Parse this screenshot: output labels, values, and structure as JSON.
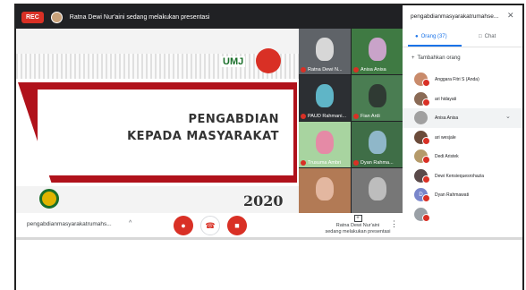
{
  "topbar": {
    "rec_label": "REC",
    "presenting_text": "Ratna Dewi Nur'aini sedang melakukan presentasi"
  },
  "slide": {
    "logo_text": "UMJ",
    "title_line1": "PENGABDIAN",
    "title_line2": "KEPADA MASYARAKAT",
    "year": "2020"
  },
  "tiles": [
    {
      "name": "Ratna Dewi N..."
    },
    {
      "name": "Anisa Anisa"
    },
    {
      "name": "PAUD Rahmani..."
    },
    {
      "name": "Fian Ardi"
    },
    {
      "name": "Trusuma Ambri"
    },
    {
      "name": "Dyan Rahma..."
    },
    {
      "name": ""
    },
    {
      "name": ""
    }
  ],
  "bottombar": {
    "meeting_name": "pengabdianmasyarakatrumahs...",
    "present_label_line1": "Ratna Dewi Nur'aini",
    "present_label_line2": "sedang melakukan presentasi"
  },
  "side": {
    "title": "pengabdianmasyarakatrumahse...",
    "tab_people": "Orang (37)",
    "tab_chat": "Chat",
    "add_people": "Tambahkan orang",
    "participants": [
      {
        "name": "Anggara Fitri S (Anda)",
        "initial": "",
        "color": "#c98b6b"
      },
      {
        "name": "ari hidayati",
        "initial": "",
        "color": "#8a6a55"
      },
      {
        "name": "Anisa Anisa",
        "initial": "",
        "color": "#a0a0a0"
      },
      {
        "name": "ari wesjale",
        "initial": "",
        "color": "#6b4b3a"
      },
      {
        "name": "Dedi Aristek",
        "initial": "",
        "color": "#b59a6a"
      },
      {
        "name": "Dewi Kensiequesrohazia",
        "initial": "",
        "color": "#5a4a4a"
      },
      {
        "name": "Dyan Rahmawati",
        "initial": "D",
        "color": "#7986cb"
      },
      {
        "name": "",
        "initial": "",
        "color": "#9aa0a6"
      }
    ]
  }
}
